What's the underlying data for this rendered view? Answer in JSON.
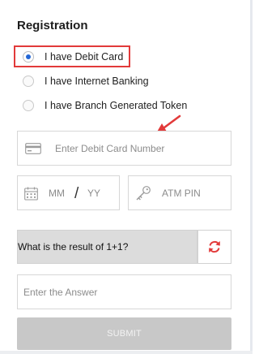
{
  "form": {
    "title": "Registration",
    "options": [
      {
        "label": "I have Debit Card",
        "selected": true
      },
      {
        "label": "I have Internet Banking",
        "selected": false
      },
      {
        "label": "I have Branch Generated Token",
        "selected": false
      }
    ],
    "card_number_placeholder": "Enter Debit Card Number",
    "month_placeholder": "MM",
    "year_placeholder": "YY",
    "date_separator": "/",
    "pin_placeholder": "ATM PIN",
    "captcha_question": "What is the result of 1+1?",
    "answer_placeholder": "Enter the Answer",
    "submit_label": "SUBMIT"
  },
  "icons": {
    "card": "credit-card-icon",
    "calendar": "calendar-icon",
    "key": "key-icon",
    "refresh": "refresh-icon",
    "annotation_arrow": "arrow-icon"
  },
  "colors": {
    "radio_selected": "#2467d6",
    "highlight": "#e23a3a",
    "refresh": "#e23a3a",
    "submit_disabled": "#c8c8c8"
  }
}
